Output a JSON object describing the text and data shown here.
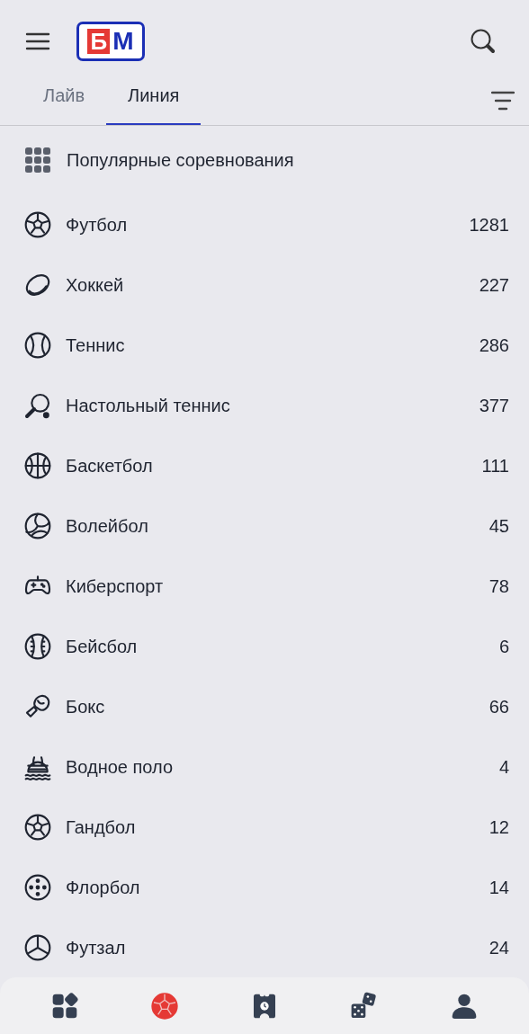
{
  "header": {
    "logo": {
      "left": "Б",
      "right": "М"
    }
  },
  "tabs": [
    {
      "label": "Лайв",
      "selected": false
    },
    {
      "label": "Линия",
      "selected": true
    }
  ],
  "popular": {
    "label": "Популярные соревнования"
  },
  "sports": [
    {
      "kind": "football",
      "name": "Футбол",
      "count": "1281"
    },
    {
      "kind": "hockey",
      "name": "Хоккей",
      "count": "227"
    },
    {
      "kind": "tennis",
      "name": "Теннис",
      "count": "286"
    },
    {
      "kind": "pingpong",
      "name": "Настольный теннис",
      "count": "377"
    },
    {
      "kind": "basketball",
      "name": "Баскетбол",
      "count": "111"
    },
    {
      "kind": "volleyball",
      "name": "Волейбол",
      "count": "45"
    },
    {
      "kind": "esports",
      "name": "Киберспорт",
      "count": "78"
    },
    {
      "kind": "baseball",
      "name": "Бейсбол",
      "count": "6"
    },
    {
      "kind": "boxing",
      "name": "Бокс",
      "count": "66"
    },
    {
      "kind": "waterpolo",
      "name": "Водное поло",
      "count": "4"
    },
    {
      "kind": "handball",
      "name": "Гандбол",
      "count": "12"
    },
    {
      "kind": "floorball",
      "name": "Флорбол",
      "count": "14"
    },
    {
      "kind": "futsal",
      "name": "Футзал",
      "count": "24"
    }
  ],
  "bottom_nav": [
    {
      "kind": "apps",
      "selected": false
    },
    {
      "kind": "ball",
      "selected": true
    },
    {
      "kind": "ticket",
      "selected": false
    },
    {
      "kind": "dice",
      "selected": false
    },
    {
      "kind": "profile",
      "selected": false
    }
  ]
}
